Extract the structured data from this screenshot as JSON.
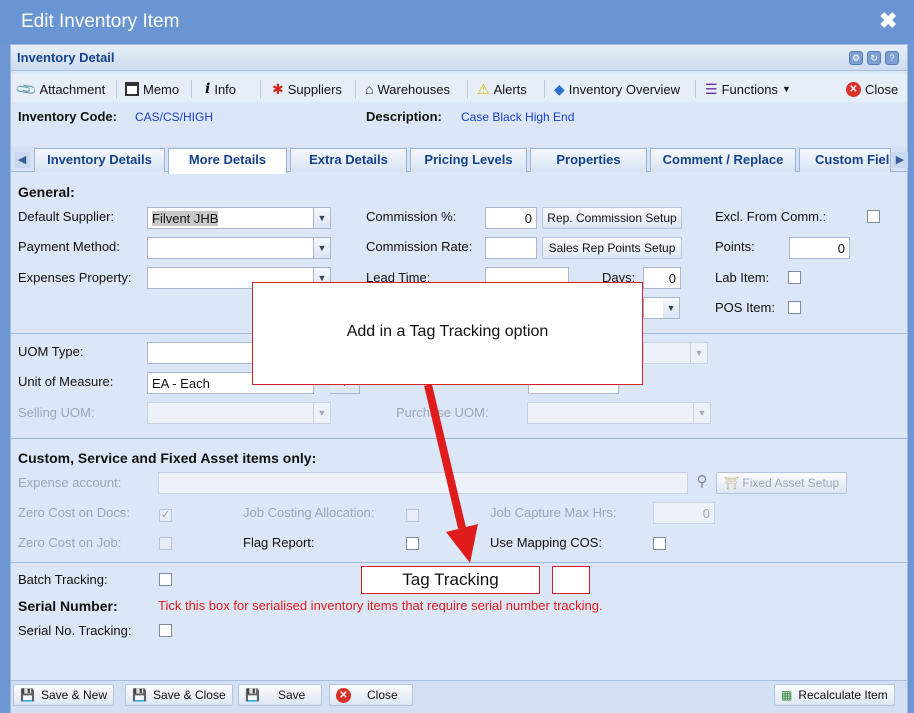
{
  "window": {
    "title": "Edit Inventory Item",
    "close_glyph": "✖"
  },
  "panel": {
    "title": "Inventory Detail"
  },
  "toolbar": {
    "attachment": "Attachment",
    "memo": "Memo",
    "info": "Info",
    "suppliers": "Suppliers",
    "warehouses": "Warehouses",
    "alerts": "Alerts",
    "inventory_overview": "Inventory Overview",
    "functions": "Functions",
    "close": "Close"
  },
  "item": {
    "code_label": "Inventory Code:",
    "code_value": "CAS/CS/HIGH",
    "desc_label": "Description:",
    "desc_value": "Case Black High End"
  },
  "tabs": [
    "Inventory Details",
    "More Details",
    "Extra Details",
    "Pricing Levels",
    "Properties",
    "Comment / Replace",
    "Custom Fields"
  ],
  "active_tab": "More Details",
  "general": {
    "heading": "General",
    "default_supplier_label": "Default Supplier:",
    "default_supplier_value": "Filvent JHB",
    "payment_method_label": "Payment Method:",
    "expenses_property_label": "Expenses Property:",
    "commission_pct_label": "Commission %:",
    "commission_pct_value": "0",
    "commission_rate_label": "Commission Rate:",
    "rep_commission_btn": "Rep. Commission Setup",
    "sales_rep_points_btn": "Sales Rep Points Setup",
    "lead_time_label": "Lead Time:",
    "days_label": "Days:",
    "days_value": "0",
    "excl_comm_label": "Excl. From Comm.:",
    "points_label": "Points:",
    "points_value": "0",
    "lab_item_label": "Lab Item:",
    "pos_item_label": "POS Item:"
  },
  "uom": {
    "uom_type_label": "UOM Type:",
    "unit_of_measure_label": "Unit of Measure:",
    "unit_of_measure_value": "EA - Each",
    "selling_uom_label": "Selling UOM:",
    "purchase_uom_label": "Purchase UOM:"
  },
  "custom": {
    "heading": "Custom, Service and Fixed Asset items only",
    "expense_account_label": "Expense account:",
    "fixed_asset_btn": "Fixed Asset Setup",
    "zero_cost_docs_label": "Zero Cost on Docs:",
    "zero_cost_job_label": "Zero Cost on Job:",
    "job_costing_label": "Job Costing Allocation:",
    "flag_report_label": "Flag Report:",
    "job_capture_label": "Job Capture Max Hrs:",
    "job_capture_value": "0",
    "use_mapping_label": "Use Mapping COS:"
  },
  "tracking": {
    "batch_label": "Batch Tracking:",
    "serial_heading": "Serial Number",
    "serial_hint": "Tick this box for serialised inventory items that require serial number tracking.",
    "serial_tracking_label": "Serial No. Tracking:"
  },
  "annotation": {
    "callout": "Add in a Tag Tracking option",
    "tag_tracking": "Tag Tracking"
  },
  "footer": {
    "save_new": "Save & New",
    "save_close": "Save & Close",
    "save": "Save",
    "close": "Close",
    "recalculate": "Recalculate Item"
  },
  "colors": {
    "title_bar": "#6a95d3",
    "accent_red": "#d4202a",
    "link_blue": "#1a3cc7"
  }
}
